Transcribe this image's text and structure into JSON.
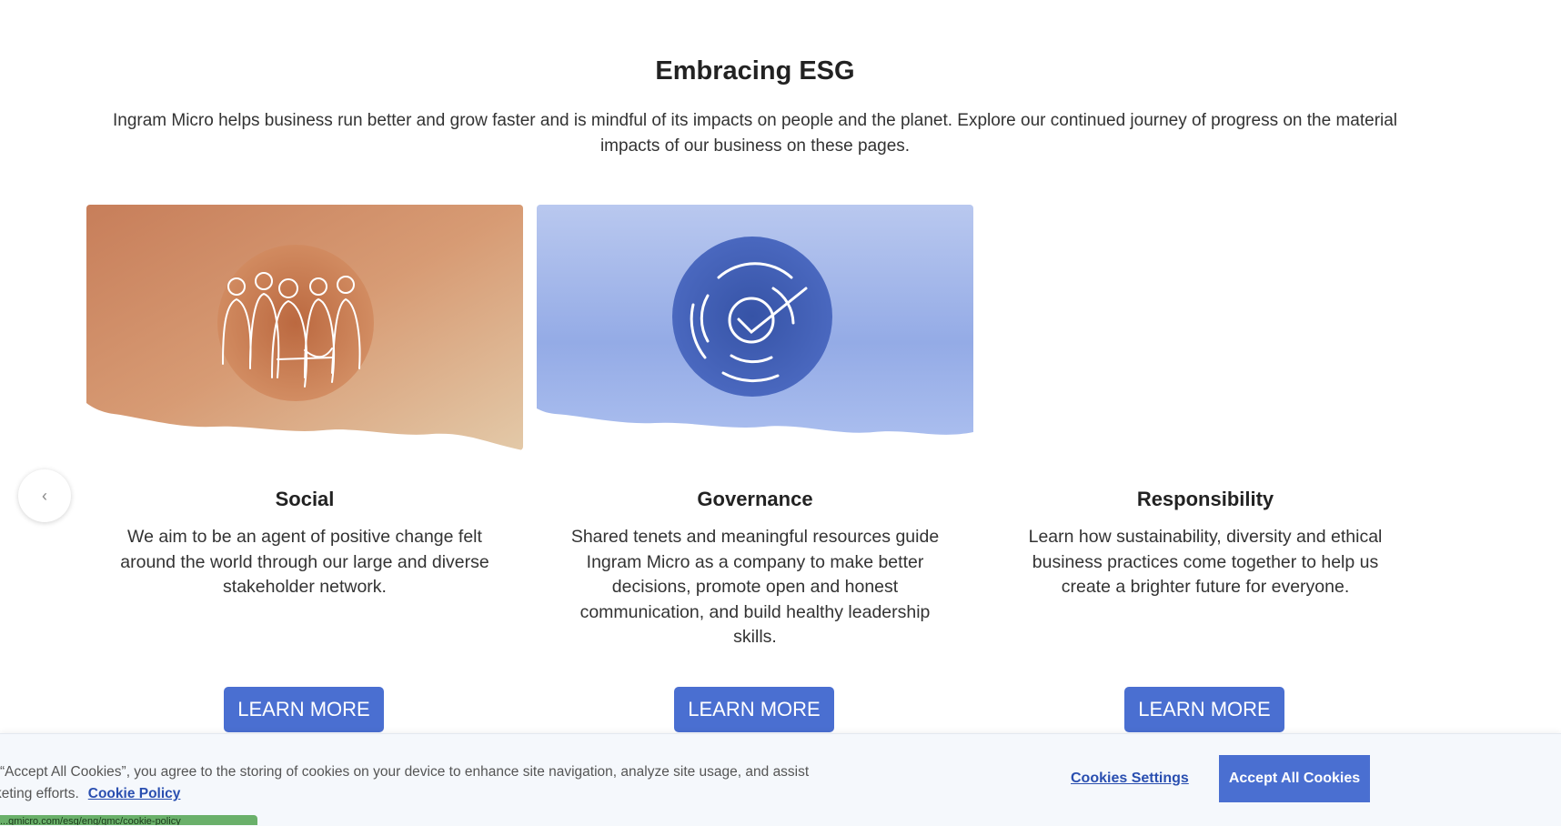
{
  "section": {
    "title": "Embracing ESG",
    "intro": "Ingram Micro helps business run better and grow faster and is mindful of its impacts on people and the planet. Explore our continued journey of progress on the material impacts of our business on these pages."
  },
  "carousel": {
    "prev_icon": "chevron-left-icon",
    "prev_glyph": "‹"
  },
  "cards": [
    {
      "title": "Social",
      "description": "We aim to be an agent of positive change felt around the world through our large and diverse stakeholder network.",
      "button": "LEARN MORE",
      "image_icon": "people-group-icon",
      "accent": "#c8865f"
    },
    {
      "title": "Governance",
      "description": "Shared tenets and meaningful resources guide Ingram Micro as a company to make better decisions, promote open and honest communication, and build healthy leadership skills.",
      "button": "LEARN MORE",
      "image_icon": "target-check-icon",
      "accent": "#3f5fb0"
    },
    {
      "title": "Responsibility",
      "description": "Learn how sustainability, diversity and ethical business practices come together to help us create a brighter future for everyone.",
      "button": "LEARN MORE"
    }
  ],
  "cookie_banner": {
    "line1": "“Accept All Cookies”, you agree to the storing of cookies on your device to enhance site navigation, analyze site usage, and assist",
    "line2": "keting efforts.",
    "policy_link": "Cookie Policy",
    "settings_label": "Cookies Settings",
    "accept_label": "Accept All Cookies"
  },
  "status_bar": {
    "url": "...gmicro.com/esg/eng/gmc/cookie-policy"
  },
  "colors": {
    "button": "#4a6fd1",
    "link": "#2a4fb0",
    "banner_bg": "#f5f8fc"
  }
}
